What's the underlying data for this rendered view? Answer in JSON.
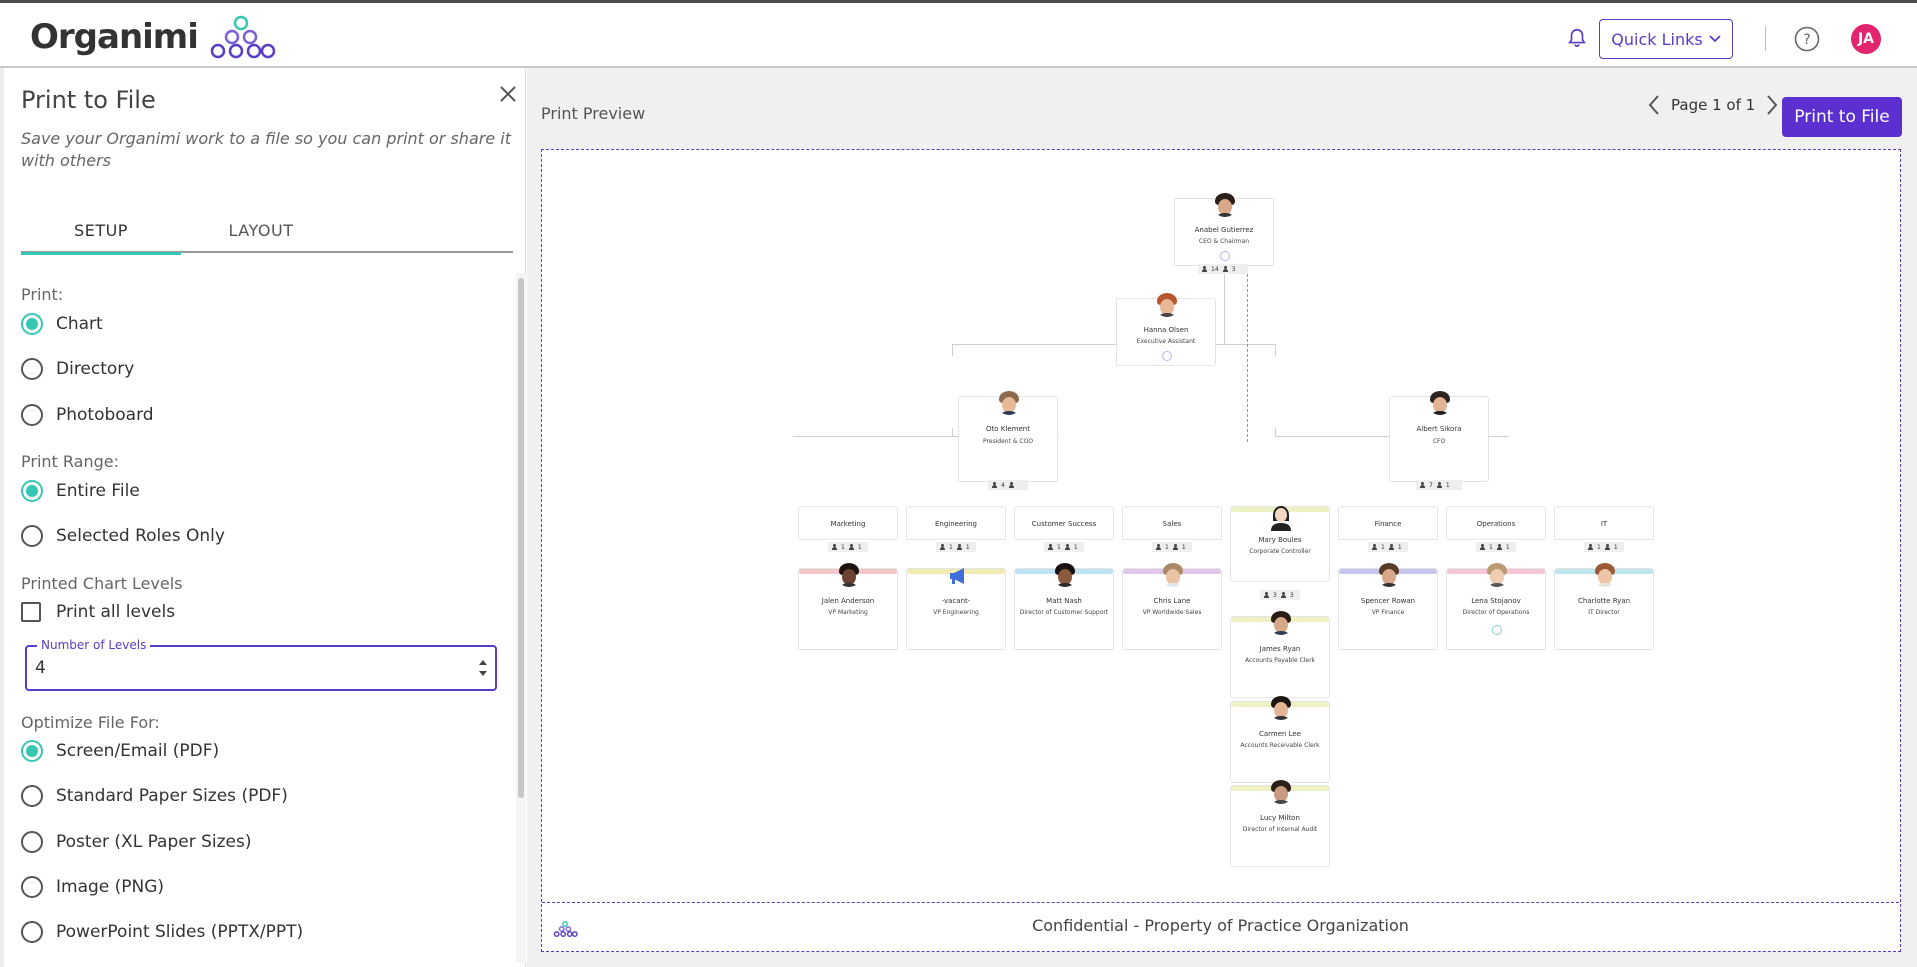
{
  "header": {
    "logo_text": "Organimi",
    "quick_links_label": "Quick Links",
    "user_initials": "JA",
    "accent_color": "#5b3cc4",
    "avatar_color": "#e3246f"
  },
  "panel": {
    "title": "Print to File",
    "description": "Save your Organimi work to a file so you can print or share it with others",
    "tabs": [
      {
        "label": "SETUP",
        "active": true
      },
      {
        "label": "LAYOUT",
        "active": false
      }
    ],
    "print_label": "Print:",
    "print_options": [
      {
        "label": "Chart",
        "checked": true
      },
      {
        "label": "Directory",
        "checked": false
      },
      {
        "label": "Photoboard",
        "checked": false
      }
    ],
    "range_label": "Print Range:",
    "range_options": [
      {
        "label": "Entire File",
        "checked": true
      },
      {
        "label": "Selected Roles Only",
        "checked": false
      }
    ],
    "levels_label": "Printed Chart Levels",
    "print_all_levels_label": "Print all levels",
    "number_of_levels_label": "Number of Levels",
    "number_of_levels_value": "4",
    "optimize_label": "Optimize File For:",
    "optimize_options": [
      {
        "label": "Screen/Email (PDF)",
        "checked": true
      },
      {
        "label": "Standard Paper Sizes (PDF)",
        "checked": false
      },
      {
        "label": "Poster (XL Paper Sizes)",
        "checked": false
      },
      {
        "label": "Image (PNG)",
        "checked": false
      },
      {
        "label": "PowerPoint Slides (PPTX/PPT)",
        "checked": false
      }
    ]
  },
  "preview": {
    "label": "Print Preview",
    "page_indicator": "Page 1 of 1",
    "print_button": "Print to File",
    "footer": "Confidential - Property of Practice Organization"
  },
  "org": {
    "ceo": {
      "name": "Anabel Gutierrez",
      "title": "CEO & Chairman",
      "count_a": "14",
      "count_b": "3"
    },
    "assistant": {
      "name": "Hanna Olsen",
      "title": "Executive Assistant"
    },
    "president": {
      "name": "Oto Klement",
      "title": "President & COO",
      "count_a": "4"
    },
    "cfo": {
      "name": "Albert Sikora",
      "title": "CFO",
      "count_a": "7",
      "count_b": "1"
    },
    "controller": {
      "name": "Mary Boules",
      "title": "Corporate Controller",
      "count_a": "3",
      "count_b": "3"
    },
    "departments": [
      {
        "name": "Marketing",
        "person": "Jalen Anderson",
        "title": "VP Marketing",
        "c1": "1",
        "c2": "1",
        "color": "#f3c7c9"
      },
      {
        "name": "Engineering",
        "person": "-vacant-",
        "title": "VP Engineering",
        "c1": "1",
        "c2": "1",
        "color": "#f2ecb4"
      },
      {
        "name": "Customer Success",
        "person": "Matt Nash",
        "title": "Director of Customer Support",
        "c1": "1",
        "c2": "1",
        "color": "#bfe3f6"
      },
      {
        "name": "Sales",
        "person": "Chris Lane",
        "title": "VP Worldwide Sales",
        "c1": "1",
        "c2": "1",
        "color": "#e0c7ea"
      },
      {
        "name": "Finance",
        "person": "Spencer Rowan",
        "title": "VP Finance",
        "c1": "1",
        "c2": "1",
        "color": "#c5c8ec"
      },
      {
        "name": "Operations",
        "person": "Lena Stojanov",
        "title": "Director of Operations",
        "c1": "1",
        "c2": "1",
        "color": "#f6c5d6"
      },
      {
        "name": "IT",
        "person": "Charlotte Ryan",
        "title": "IT Director",
        "c1": "1",
        "c2": "1",
        "color": "#bde6ef"
      }
    ],
    "controller_reports": [
      {
        "name": "James Ryan",
        "title": "Accounts Payable Clerk"
      },
      {
        "name": "Carmen Lee",
        "title": "Accounts Receivable Clerk"
      },
      {
        "name": "Lucy Milton",
        "title": "Director of Internal Audit"
      }
    ]
  }
}
